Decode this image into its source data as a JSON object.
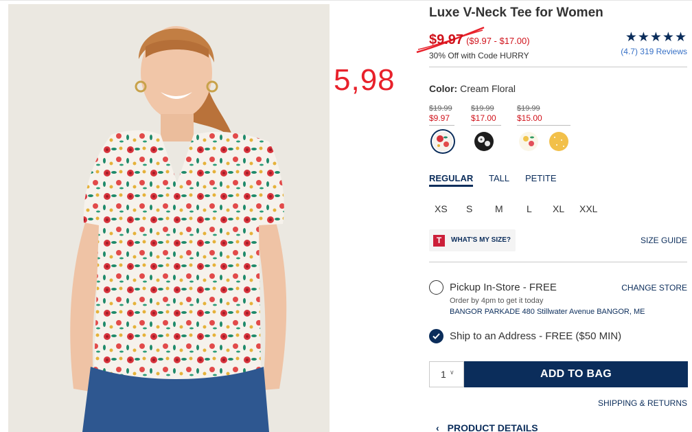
{
  "annotation": {
    "text": "5,98",
    "color": "#e8212b"
  },
  "product": {
    "title": "Luxe V-Neck Tee for Women",
    "price": "$9.97",
    "price_range": "($9.97 - $17.00)",
    "promo": "30% Off with Code HURRY",
    "rating_stars": "★★★★★",
    "rating_value": 4.7,
    "reviews": "(4.7) 319 Reviews"
  },
  "color": {
    "label": "Color:",
    "selected": "Cream Floral",
    "price_groups": [
      {
        "old": "$19.99",
        "new": "$9.97"
      },
      {
        "old": "$19.99",
        "new": "$17.00"
      },
      {
        "old": "$19.99",
        "new": "$15.00"
      }
    ],
    "swatches": [
      "cream-floral-swatch",
      "black-floral-swatch",
      "yellow-floral-swatch",
      "yellow-dot-swatch"
    ]
  },
  "fit_tabs": [
    "REGULAR",
    "TALL",
    "PETITE"
  ],
  "sizes": [
    "XS",
    "S",
    "M",
    "L",
    "XL",
    "XXL"
  ],
  "size_tools": {
    "logo": "T",
    "whats_my_size": "WHAT'S MY SIZE?",
    "size_guide": "SIZE GUIDE"
  },
  "fulfillment": {
    "pickup_label": "Pickup In-Store - FREE",
    "change_store": "CHANGE STORE",
    "order_by": "Order by 4pm to get it today",
    "store_address": "BANGOR PARKADE 480 Stillwater Avenue  BANGOR, ME",
    "ship_label": "Ship to an Address - FREE ($50 MIN)",
    "ship_selected": true
  },
  "cart": {
    "qty": "1",
    "add_to_bag": "ADD TO BAG",
    "shipping_returns": "SHIPPING & RETURNS"
  },
  "details": {
    "label": "PRODUCT DETAILS"
  },
  "colors": {
    "navy": "#0b2d5b",
    "sale_red": "#d0121b",
    "link_blue": "#3670c6"
  }
}
